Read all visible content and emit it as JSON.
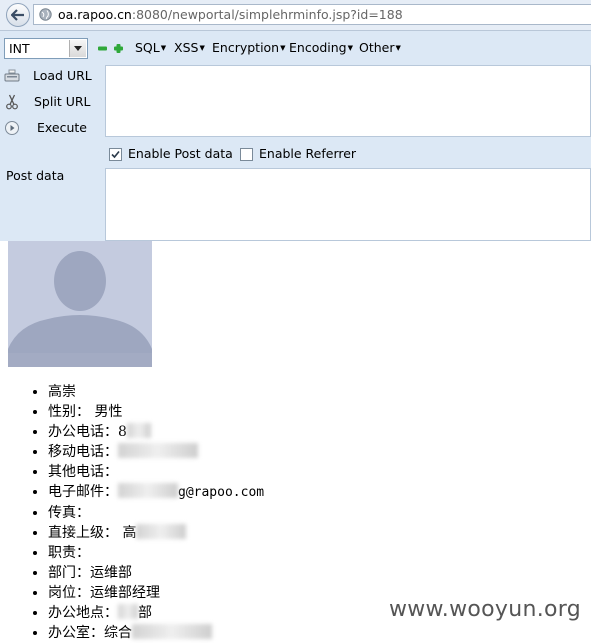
{
  "browser": {
    "url_host": "oa.rapoo.cn",
    "url_rest": ":8080/newportal/simplehrminfo.jsp?id=188"
  },
  "hackbar": {
    "type_select": "INT",
    "menus": [
      "SQL",
      "XSS",
      "Encryption",
      "Encoding",
      "Other"
    ],
    "load_url": "Load URL",
    "split_url": "Split URL",
    "execute": "Execute",
    "url_value": "",
    "enable_post": "Enable Post data",
    "enable_post_checked": true,
    "enable_referrer": "Enable Referrer",
    "enable_referrer_checked": false,
    "post_data_label": "Post data",
    "post_value": ""
  },
  "profile": {
    "name": "高崇",
    "gender": "性别： 男性",
    "office_phone": "办公电话：8",
    "mobile_phone": "移动电话：",
    "other_phone": "其他电话：",
    "email_label": "电子邮件：",
    "email_suffix": "g@rapoo.com",
    "fax": "传真：",
    "manager": "直接上级： ",
    "manager_partial": "高",
    "duty": "职责：",
    "department": "部门：运维部",
    "position": "岗位：运维部经理",
    "location_label": "办公地点：",
    "location_partial": "部",
    "room_label": "办公室：",
    "room_partial": "综合"
  },
  "watermark": "www.wooyun.org"
}
